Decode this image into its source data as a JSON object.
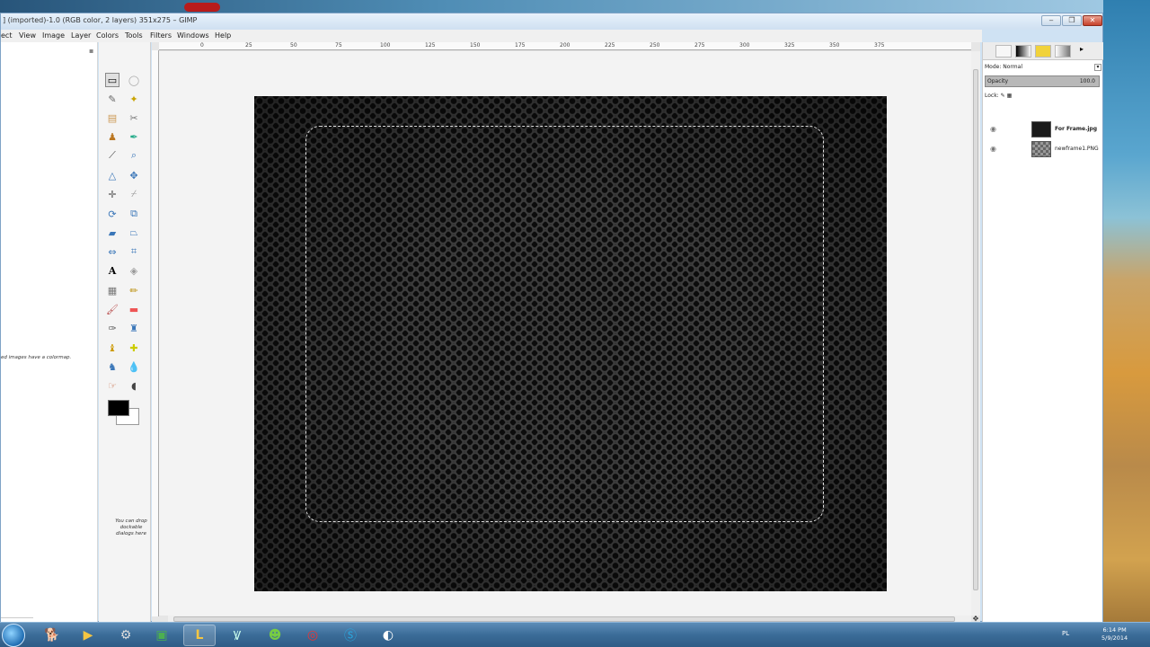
{
  "window": {
    "title": "] (imported)-1.0 (RGB color, 2 layers) 351x275 – GIMP",
    "min_label": "‒",
    "max_label": "❐",
    "close_label": "✕"
  },
  "menu": [
    "ect",
    "View",
    "Image",
    "Layer",
    "Colors",
    "Tools",
    "Filters",
    "Windows",
    "Help"
  ],
  "toolbox": {
    "message": "ed images have a colormap.",
    "drop_hint": "You can drop dockable dialogs here"
  },
  "ruler": {
    "ticks": [
      "-25",
      "0",
      "25",
      "50",
      "75",
      "100",
      "125",
      "150",
      "175",
      "200",
      "225",
      "250",
      "275",
      "300",
      "325",
      "350",
      "375"
    ]
  },
  "layers_panel": {
    "mode_label": "Mode: Normal",
    "opacity_label": "Opacity",
    "opacity_value": "100.0",
    "lock_label": "Lock:",
    "layers": [
      {
        "name": "For Frame.jpg",
        "visible": true
      },
      {
        "name": "newframe1.PNG",
        "visible": true
      }
    ]
  },
  "tray": {
    "language": "PL",
    "time": "6:14 PM",
    "date": "5/9/2014"
  },
  "colors": {
    "foreground": "#000000",
    "background": "#ffffff"
  }
}
